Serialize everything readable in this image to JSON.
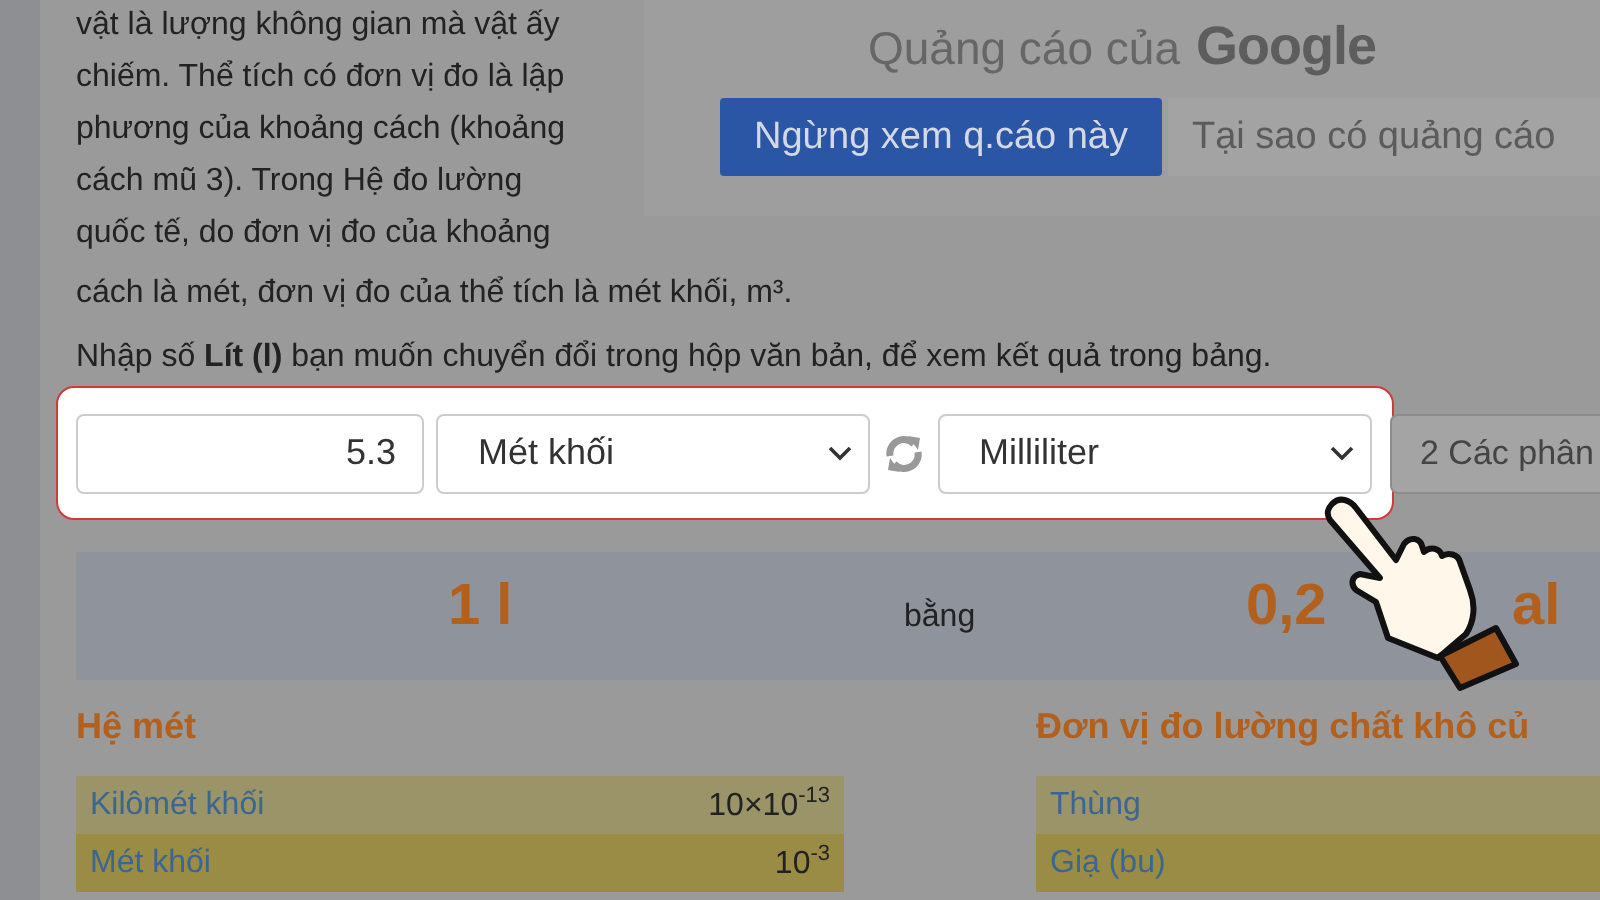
{
  "article": {
    "lines": [
      "vật là lượng không gian mà vật ấy",
      "chiếm. Thể tích có đơn vị đo là lập",
      "phương của khoảng cách (khoảng",
      "cách mũ 3). Trong Hệ đo lường",
      "quốc tế, do đơn vị đo của khoảng",
      "cách là mét, đơn vị đo của thể tích là mét khối, m³."
    ],
    "instruction": "Nhập số **Lít (l)** bạn muốn chuyển đổi trong hộp văn bản, để xem kết quả trong bảng."
  },
  "ad": {
    "caption": "Quảng cáo của",
    "brand": "Google",
    "buttons": [
      {
        "label": "Ngừng xem q.cáo này",
        "kind": "primary"
      },
      {
        "label": "Tại sao có quảng cáo",
        "kind": "secondary"
      }
    ]
  },
  "converter": {
    "value": "5.3",
    "from_unit": "Mét khối",
    "to_unit": "Milliliter",
    "side_button": "2 Các phân"
  },
  "result": {
    "from": "1 l",
    "word": "bằng",
    "to_start": "0,2",
    "to_end": "al"
  },
  "tables": [
    {
      "title": "Hệ mét",
      "rows": [
        {
          "name": "Kilômét khối",
          "value": "10×10$^{-13}$"
        },
        {
          "name": "Mét khối",
          "value": "10$^{-3}$"
        }
      ]
    },
    {
      "title": "Đơn vị đo lường chất khô củ",
      "rows": [
        {
          "name": "Thùng"
        },
        {
          "name": "Giạ (bu)"
        }
      ]
    }
  ]
}
